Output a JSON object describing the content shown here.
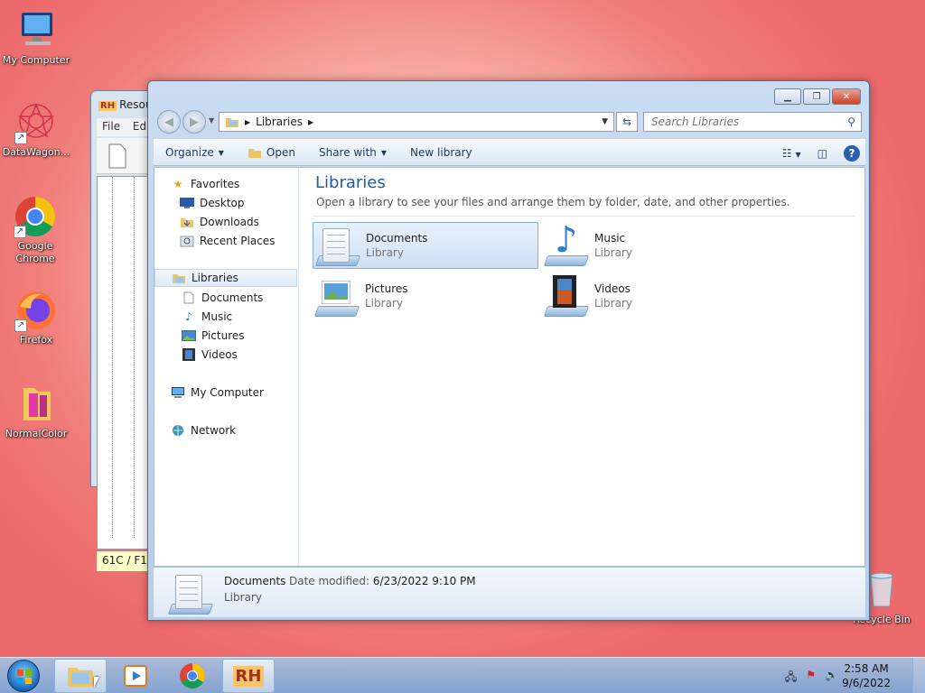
{
  "desktop": {
    "icons": [
      {
        "label": "My Computer"
      },
      {
        "label": "DataWagon..."
      },
      {
        "label": "Google Chrome"
      },
      {
        "label": "Firefox"
      },
      {
        "label": "NormalColor"
      },
      {
        "label": "Recycle Bin"
      }
    ]
  },
  "back_window": {
    "logo": "RH",
    "title": "Resou",
    "menu": [
      "File",
      "Edi"
    ],
    "status": "61C / F1"
  },
  "explorer": {
    "address": {
      "crumb": "Libraries"
    },
    "search": {
      "placeholder": "Search Libraries"
    },
    "toolbar": {
      "organize": "Organize",
      "open": "Open",
      "share_with": "Share with",
      "new_library": "New library"
    },
    "nav": {
      "favorites": "Favorites",
      "desktop": "Desktop",
      "downloads": "Downloads",
      "recent_places": "Recent Places",
      "libraries": "Libraries",
      "documents": "Documents",
      "music": "Music",
      "pictures": "Pictures",
      "videos": "Videos",
      "my_computer": "My Computer",
      "network": "Network"
    },
    "content": {
      "title": "Libraries",
      "subtitle": "Open a library to see your files and arrange them by folder, date, and other properties.",
      "libraries": [
        {
          "name": "Documents",
          "type": "Library"
        },
        {
          "name": "Music",
          "type": "Library"
        },
        {
          "name": "Pictures",
          "type": "Library"
        },
        {
          "name": "Videos",
          "type": "Library"
        }
      ]
    },
    "details": {
      "name": "Documents",
      "modified_label": "Date modified:",
      "modified_value": "6/23/2022 9:10 PM",
      "type": "Library"
    }
  },
  "taskbar": {
    "time": "2:58 AM",
    "date": "9/6/2022",
    "rh_logo": "RH"
  },
  "colors": {
    "accent": "#1e5aa8",
    "selection": "#cfe0f5",
    "close": "#c7442c"
  }
}
